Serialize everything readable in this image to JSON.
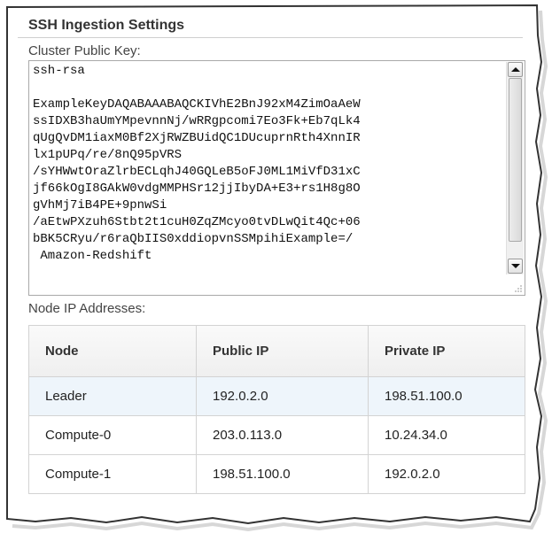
{
  "settings": {
    "title": "SSH Ingestion Settings",
    "key_label": "Cluster Public Key:",
    "public_key": "ssh-rsa\n\nExampleKeyDAQABAAABAQCKIVhE2BnJ92xM4ZimOaAeW\nssIDXB3haUmYMpevnnNj/wRRgpcomi7Eo3Fk+Eb7qLk4\nqUgQvDM1iaxM0Bf2XjRWZBUidQC1DUcuprnRth4XnnIR\nlx1pUPq/re/8nQ95pVRS\n/sYHWwtOraZlrbECLqhJ40GQLeB5oFJ0ML1MiVfD31xC\njf66kOgI8GAkW0vdgMMPHSr12jjIbyDA+E3+rs1H8g8O\ngVhMj7iB4PE+9pnwSi\n/aEtwPXzuh6Stbt2t1cuH0ZqZMcyo0tvDLwQit4Qc+06\nbBK5CRyu/r6raQbIIS0xddiopvnSSMpihiExample=/\n Amazon-Redshift",
    "nodes_label": "Node IP Addresses:",
    "columns": [
      "Node",
      "Public IP",
      "Private IP"
    ],
    "rows": [
      {
        "node": "Leader",
        "public_ip": "192.0.2.0",
        "private_ip": "198.51.100.0",
        "highlighted": true
      },
      {
        "node": "Compute-0",
        "public_ip": "203.0.113.0",
        "private_ip": "10.24.34.0",
        "highlighted": false
      },
      {
        "node": "Compute-1",
        "public_ip": "198.51.100.0",
        "private_ip": "192.0.2.0",
        "highlighted": false
      }
    ]
  }
}
